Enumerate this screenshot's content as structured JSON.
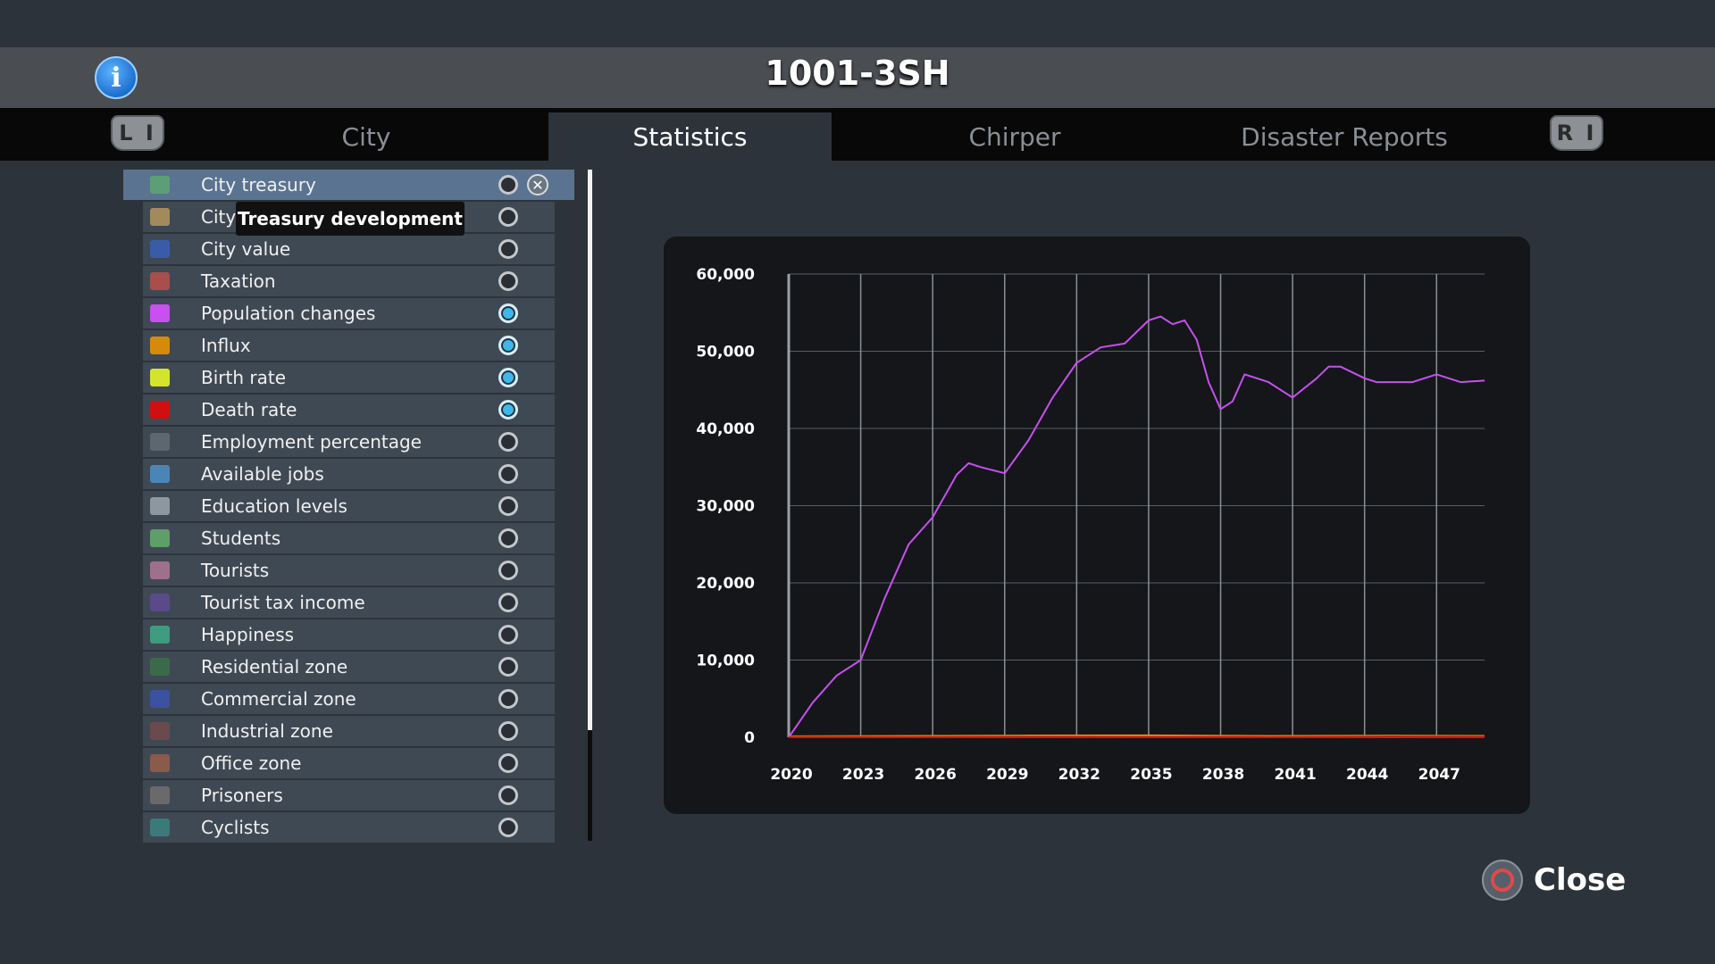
{
  "header": {
    "title": "1001-3SH"
  },
  "tabs": [
    {
      "label": "City"
    },
    {
      "label": "Statistics",
      "active": true
    },
    {
      "label": "Chirper"
    },
    {
      "label": "Disaster Reports"
    }
  ],
  "shoulder_buttons": {
    "left": "L I",
    "right": "R I"
  },
  "tooltip": "Treasury development",
  "stats_list": [
    {
      "label": "City treasury",
      "color": "#5e9e77",
      "enabled": false,
      "selected": true
    },
    {
      "label": "City",
      "color": "#a38a5c",
      "enabled": false
    },
    {
      "label": "City value",
      "color": "#3a5ca8",
      "enabled": false
    },
    {
      "label": "Taxation",
      "color": "#a84e4b",
      "enabled": false
    },
    {
      "label": "Population changes",
      "color": "#c84ff0",
      "enabled": true
    },
    {
      "label": "Influx",
      "color": "#d68a0c",
      "enabled": true
    },
    {
      "label": "Birth rate",
      "color": "#d4e42c",
      "enabled": true
    },
    {
      "label": "Death rate",
      "color": "#d01010",
      "enabled": true
    },
    {
      "label": "Employment percentage",
      "color": "#5c6870",
      "enabled": false
    },
    {
      "label": "Available jobs",
      "color": "#4a86b5",
      "enabled": false
    },
    {
      "label": "Education levels",
      "color": "#8d979f",
      "enabled": false
    },
    {
      "label": "Students",
      "color": "#5e9e68",
      "enabled": false
    },
    {
      "label": "Tourists",
      "color": "#a06f8c",
      "enabled": false
    },
    {
      "label": "Tourist tax income",
      "color": "#5a4a8a",
      "enabled": false
    },
    {
      "label": "Happiness",
      "color": "#3f9c80",
      "enabled": false
    },
    {
      "label": "Residential zone",
      "color": "#3a6a4a",
      "enabled": false
    },
    {
      "label": "Commercial zone",
      "color": "#3c52a0",
      "enabled": false
    },
    {
      "label": "Industrial zone",
      "color": "#6a4a4e",
      "enabled": false
    },
    {
      "label": "Office zone",
      "color": "#8a5a4a",
      "enabled": false
    },
    {
      "label": "Prisoners",
      "color": "#6a6a6a",
      "enabled": false
    },
    {
      "label": "Cyclists",
      "color": "#3a7a7a",
      "enabled": false
    }
  ],
  "close_button": {
    "label": "Close"
  },
  "chart_data": {
    "type": "line",
    "ylim": [
      0,
      60000
    ],
    "yticks": [
      "0",
      "10,000",
      "20,000",
      "30,000",
      "40,000",
      "50,000",
      "60,000"
    ],
    "xlim": [
      2020,
      2049
    ],
    "xticks": [
      "2020",
      "2023",
      "2026",
      "2029",
      "2032",
      "2035",
      "2038",
      "2041",
      "2044",
      "2047"
    ],
    "grid": true,
    "series": [
      {
        "color": "#c84ff0",
        "x": [
          2020,
          2021,
          2022,
          2023,
          2024,
          2025,
          2026,
          2027,
          2027.5,
          2028,
          2029,
          2030,
          2031,
          2032,
          2032.5,
          2033,
          2034,
          2034.5,
          2035,
          2035.5,
          2036,
          2036.5,
          2037,
          2037.5,
          2038,
          2038.5,
          2039,
          2040,
          2040.5,
          2041,
          2042,
          2042.5,
          2043,
          2044,
          2044.5,
          2045,
          2046,
          2047,
          2048,
          2049
        ],
        "y": [
          0,
          4500,
          8000,
          10000,
          18000,
          25000,
          28500,
          34000,
          35500,
          35000,
          34200,
          38500,
          44000,
          48500,
          49500,
          50500,
          51000,
          52500,
          54000,
          54500,
          53500,
          54000,
          51500,
          46000,
          42500,
          43500,
          47000,
          46000,
          45000,
          44000,
          46500,
          48000,
          48000,
          46500,
          46000,
          46000,
          46000,
          47000,
          46000,
          46200
        ]
      },
      {
        "color": "#d68a0c",
        "x": [
          2020,
          2025,
          2030,
          2035,
          2040,
          2045,
          2049
        ],
        "y": [
          100,
          150,
          200,
          220,
          150,
          180,
          160
        ]
      },
      {
        "color": "#d4e42c",
        "x": [
          2020,
          2025,
          2030,
          2035,
          2040,
          2045,
          2049
        ],
        "y": [
          60,
          90,
          110,
          130,
          80,
          100,
          90
        ]
      },
      {
        "color": "#d01010",
        "x": [
          2020,
          2025,
          2030,
          2035,
          2040,
          2045,
          2049
        ],
        "y": [
          20,
          40,
          60,
          50,
          40,
          70,
          60
        ]
      }
    ]
  }
}
